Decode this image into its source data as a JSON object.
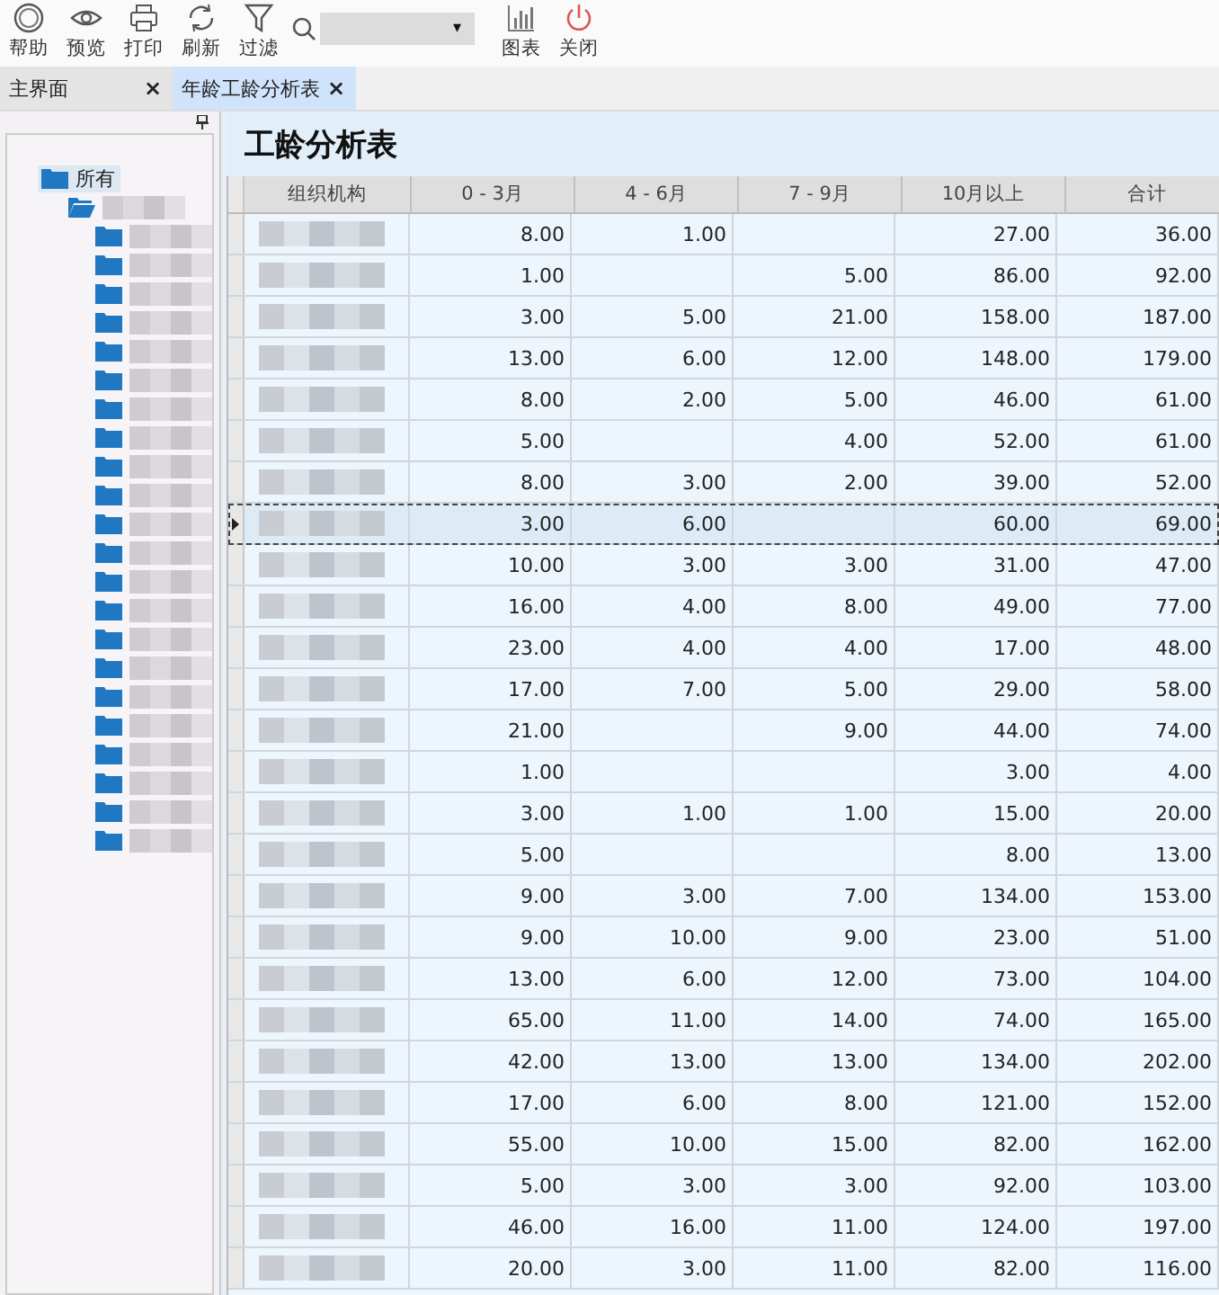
{
  "toolbar": [
    {
      "kind": "help",
      "label": "帮助"
    },
    {
      "kind": "preview",
      "label": "预览"
    },
    {
      "kind": "print",
      "label": "打印"
    },
    {
      "kind": "refresh",
      "label": "刷新"
    },
    {
      "kind": "filter",
      "label": "过滤"
    },
    {
      "kind": "search",
      "dropdown": "▾"
    },
    {
      "kind": "chart",
      "label": "图表"
    },
    {
      "kind": "close",
      "label": "关闭"
    }
  ],
  "tabs": [
    {
      "label": "主界面",
      "selected": false,
      "close": "×"
    },
    {
      "label": "年龄工龄分析表",
      "selected": true,
      "close": "×"
    }
  ],
  "tree": {
    "label": "所有",
    "children": [
      {
        "expanded": true,
        "children": [
          {
            "expanded": false
          },
          {
            "expanded": false
          },
          {
            "expanded": false
          },
          {
            "expanded": false
          },
          {
            "expanded": false
          },
          {
            "expanded": false
          },
          {
            "expanded": false
          },
          {
            "expanded": false
          },
          {
            "expanded": false
          },
          {
            "expanded": false
          },
          {
            "expanded": false
          },
          {
            "expanded": false
          },
          {
            "expanded": false
          },
          {
            "expanded": false
          },
          {
            "expanded": false
          },
          {
            "expanded": false
          },
          {
            "expanded": false
          },
          {
            "expanded": false
          },
          {
            "expanded": false
          },
          {
            "expanded": false
          },
          {
            "expanded": false
          },
          {
            "expanded": false
          }
        ]
      }
    ]
  },
  "report": {
    "title": "工龄分析表",
    "columns": [
      "组织机构",
      "0 - 3月",
      "4 - 6月",
      "7 - 9月",
      "10月以上",
      "合计"
    ],
    "rows": [
      {
        "selected": false,
        "cells": [
          "8.00",
          "1.00",
          "",
          "27.00",
          "36.00"
        ]
      },
      {
        "selected": false,
        "cells": [
          "1.00",
          "",
          "5.00",
          "86.00",
          "92.00"
        ]
      },
      {
        "selected": false,
        "cells": [
          "3.00",
          "5.00",
          "21.00",
          "158.00",
          "187.00"
        ]
      },
      {
        "selected": false,
        "cells": [
          "13.00",
          "6.00",
          "12.00",
          "148.00",
          "179.00"
        ]
      },
      {
        "selected": false,
        "cells": [
          "8.00",
          "2.00",
          "5.00",
          "46.00",
          "61.00"
        ]
      },
      {
        "selected": false,
        "cells": [
          "5.00",
          "",
          "4.00",
          "52.00",
          "61.00"
        ]
      },
      {
        "selected": false,
        "cells": [
          "8.00",
          "3.00",
          "2.00",
          "39.00",
          "52.00"
        ]
      },
      {
        "selected": true,
        "cells": [
          "3.00",
          "6.00",
          "",
          "60.00",
          "69.00"
        ]
      },
      {
        "selected": false,
        "cells": [
          "10.00",
          "3.00",
          "3.00",
          "31.00",
          "47.00"
        ]
      },
      {
        "selected": false,
        "cells": [
          "16.00",
          "4.00",
          "8.00",
          "49.00",
          "77.00"
        ]
      },
      {
        "selected": false,
        "cells": [
          "23.00",
          "4.00",
          "4.00",
          "17.00",
          "48.00"
        ]
      },
      {
        "selected": false,
        "cells": [
          "17.00",
          "7.00",
          "5.00",
          "29.00",
          "58.00"
        ]
      },
      {
        "selected": false,
        "cells": [
          "21.00",
          "",
          "9.00",
          "44.00",
          "74.00"
        ]
      },
      {
        "selected": false,
        "cells": [
          "1.00",
          "",
          "",
          "3.00",
          "4.00"
        ]
      },
      {
        "selected": false,
        "cells": [
          "3.00",
          "1.00",
          "1.00",
          "15.00",
          "20.00"
        ]
      },
      {
        "selected": false,
        "cells": [
          "5.00",
          "",
          "",
          "8.00",
          "13.00"
        ]
      },
      {
        "selected": false,
        "cells": [
          "9.00",
          "3.00",
          "7.00",
          "134.00",
          "153.00"
        ]
      },
      {
        "selected": false,
        "cells": [
          "9.00",
          "10.00",
          "9.00",
          "23.00",
          "51.00"
        ]
      },
      {
        "selected": false,
        "cells": [
          "13.00",
          "6.00",
          "12.00",
          "73.00",
          "104.00"
        ]
      },
      {
        "selected": false,
        "cells": [
          "65.00",
          "11.00",
          "14.00",
          "74.00",
          "165.00"
        ]
      },
      {
        "selected": false,
        "cells": [
          "42.00",
          "13.00",
          "13.00",
          "134.00",
          "202.00"
        ]
      },
      {
        "selected": false,
        "cells": [
          "17.00",
          "6.00",
          "8.00",
          "121.00",
          "152.00"
        ]
      },
      {
        "selected": false,
        "cells": [
          "55.00",
          "10.00",
          "15.00",
          "82.00",
          "162.00"
        ]
      },
      {
        "selected": false,
        "cells": [
          "5.00",
          "3.00",
          "3.00",
          "92.00",
          "103.00"
        ]
      },
      {
        "selected": false,
        "cells": [
          "46.00",
          "16.00",
          "11.00",
          "124.00",
          "197.00"
        ]
      },
      {
        "selected": false,
        "cells": [
          "20.00",
          "3.00",
          "11.00",
          "82.00",
          "116.00"
        ]
      }
    ]
  }
}
